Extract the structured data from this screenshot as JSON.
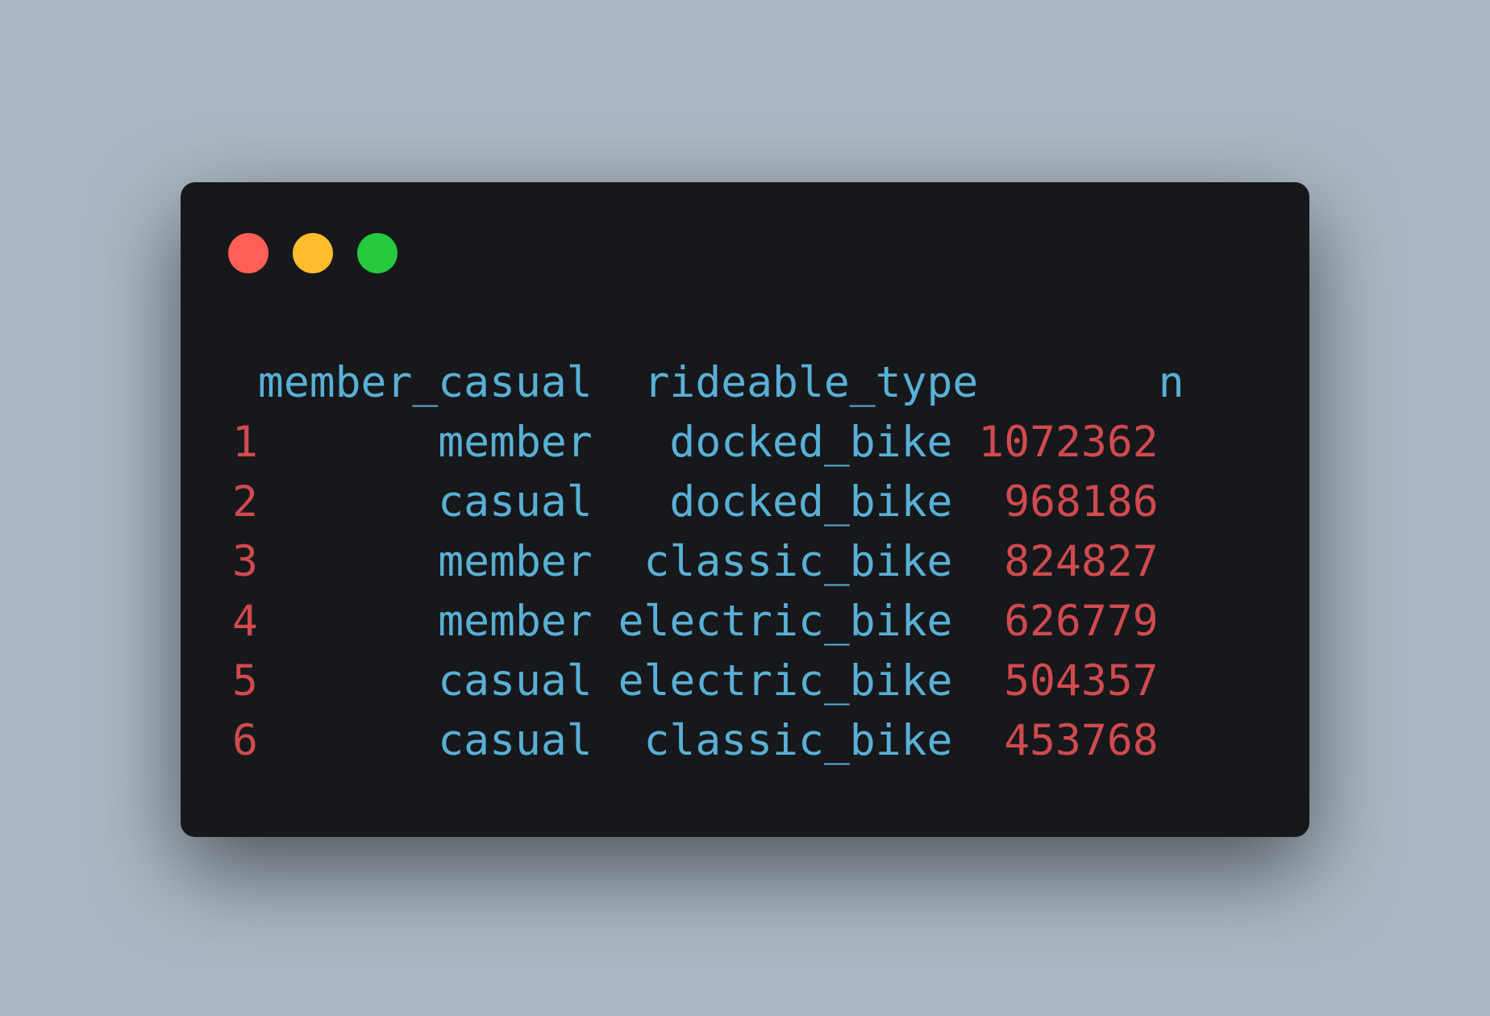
{
  "colors": {
    "background": "#abb8c3",
    "window": "#17181b",
    "text_blue": "#59b0d6",
    "text_red": "#d04a4f",
    "dot_close": "#ff5f56",
    "dot_minimize": "#ffbd2e",
    "dot_zoom": "#27c93f"
  },
  "window_controls": [
    "close-dot",
    "minimize-dot",
    "zoom-dot"
  ],
  "table": {
    "headers": [
      "member_casual",
      "rideable_type",
      "n"
    ],
    "rows": [
      {
        "index": "1",
        "member_casual": "member",
        "rideable_type": "docked_bike",
        "n": "1072362"
      },
      {
        "index": "2",
        "member_casual": "casual",
        "rideable_type": "docked_bike",
        "n": "968186"
      },
      {
        "index": "3",
        "member_casual": "member",
        "rideable_type": "classic_bike",
        "n": "824827"
      },
      {
        "index": "4",
        "member_casual": "member",
        "rideable_type": "electric_bike",
        "n": "626779"
      },
      {
        "index": "5",
        "member_casual": "casual",
        "rideable_type": "electric_bike",
        "n": "504357"
      },
      {
        "index": "6",
        "member_casual": "casual",
        "rideable_type": "classic_bike",
        "n": "453768"
      }
    ]
  }
}
